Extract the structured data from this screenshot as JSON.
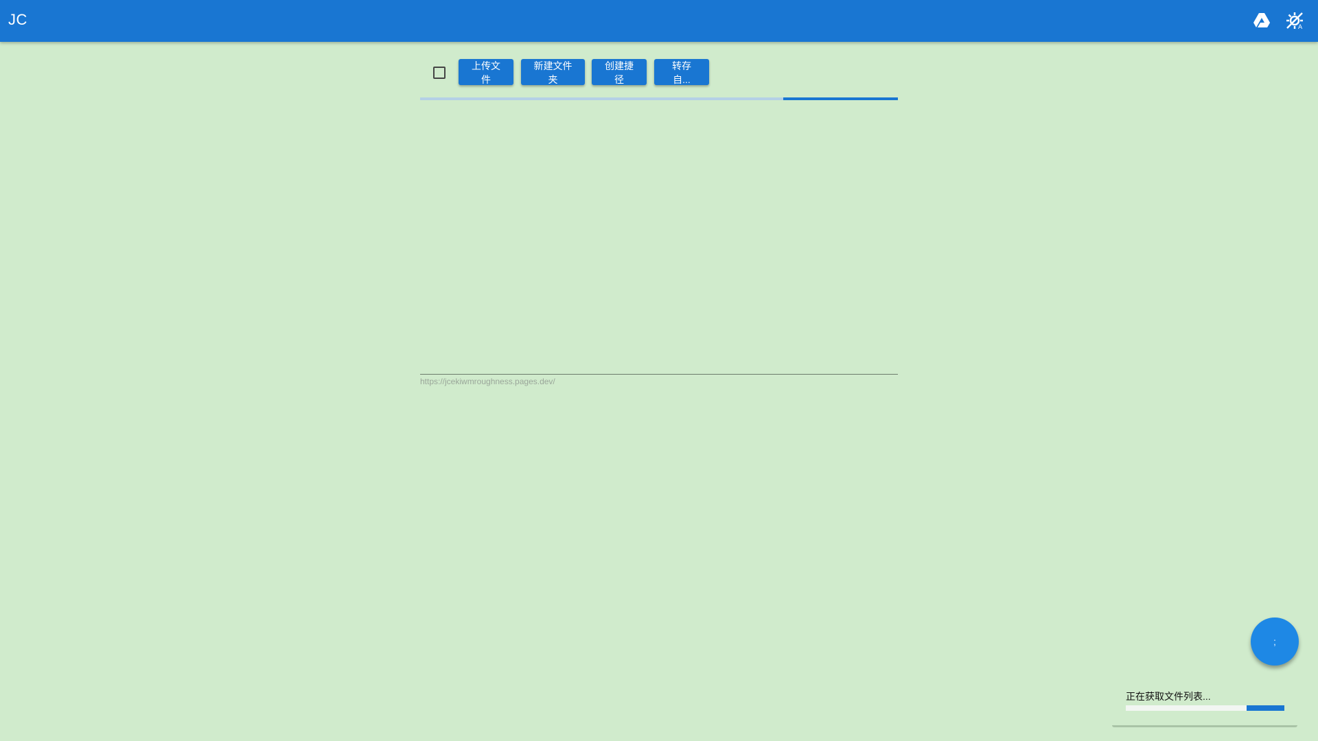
{
  "appbar": {
    "title": "JC",
    "icons": [
      "google-drive-icon",
      "theme-toggle-icon"
    ]
  },
  "toolbar": {
    "select_all": false,
    "buttons": [
      {
        "id": "upload",
        "label": "上传文件"
      },
      {
        "id": "new-folder",
        "label": "新建文件夹"
      },
      {
        "id": "create-shortcut",
        "label": "创建捷径"
      },
      {
        "id": "transfer-from",
        "label": "转存自..."
      }
    ]
  },
  "loading_bar": {
    "indeterminate": true,
    "segment_start": 0.76,
    "segment_end": 1.0
  },
  "footer": {
    "url": "https://jcekiwmroughness.pages.dev/"
  },
  "fab": {
    "label": ";"
  },
  "snackbar": {
    "message": "正在获取文件列表...",
    "progress_start": 0.76,
    "progress_end": 1.0
  },
  "colors": {
    "background": "#d0ebcc",
    "primary": "#1976d2",
    "fab": "#1e88e5"
  }
}
